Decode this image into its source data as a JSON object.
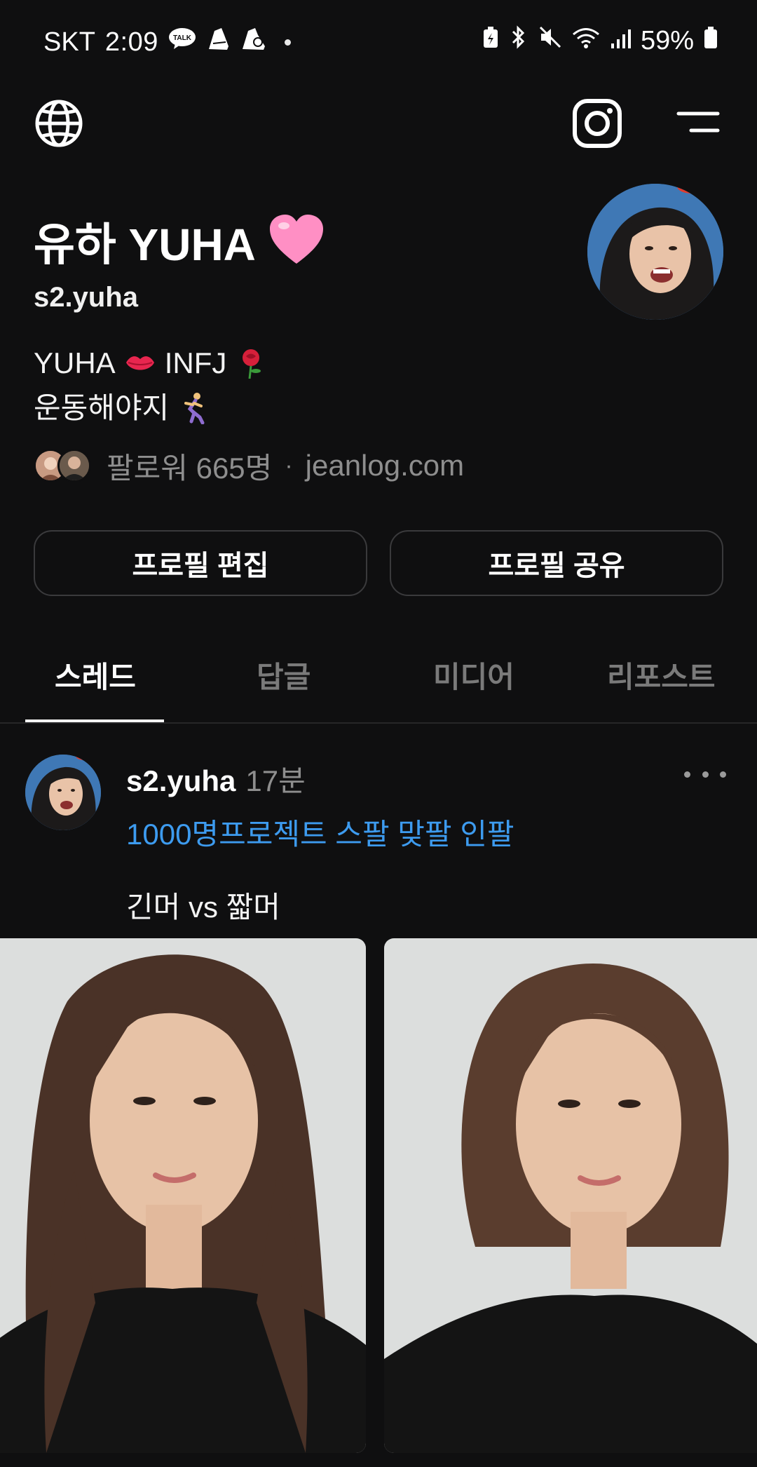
{
  "status_bar": {
    "carrier": "SKT",
    "time": "2:09",
    "talk_label": "TALK",
    "battery": "59%",
    "icons": [
      "kakaotalk-icon",
      "running-shoe-icon",
      "running-shoe-icon",
      "battery-saver-icon",
      "bluetooth-icon",
      "mute-icon",
      "wifi-icon",
      "signal-icon",
      "battery-icon"
    ]
  },
  "top_nav": {
    "icons": [
      "globe-icon",
      "instagram-icon",
      "menu-icon"
    ]
  },
  "profile": {
    "display_name": "유하 YUHA",
    "name_emoji": "pink-heart",
    "handle": "s2.yuha",
    "bio_line1_a": "YUHA",
    "bio_line1_b": "INFJ",
    "bio_line2": "운동해야지",
    "followers_text": "팔로워 665명",
    "link": "jeanlog.com"
  },
  "buttons": {
    "edit_profile": "프로필 편집",
    "share_profile": "프로필 공유"
  },
  "tabs": [
    {
      "label": "스레드",
      "active": true
    },
    {
      "label": "답글",
      "active": false
    },
    {
      "label": "미디어",
      "active": false
    },
    {
      "label": "리포스트",
      "active": false
    }
  ],
  "post": {
    "username": "s2.yuha",
    "time": "17분",
    "tag": "1000명프로젝트 스팔 맞팔 인팔",
    "text": "긴머 vs 짧머"
  },
  "colors": {
    "background": "#0f0f10",
    "accent_link": "#3d9bef",
    "muted_text": "#8e8e8e",
    "button_border": "#3a3a3c"
  }
}
